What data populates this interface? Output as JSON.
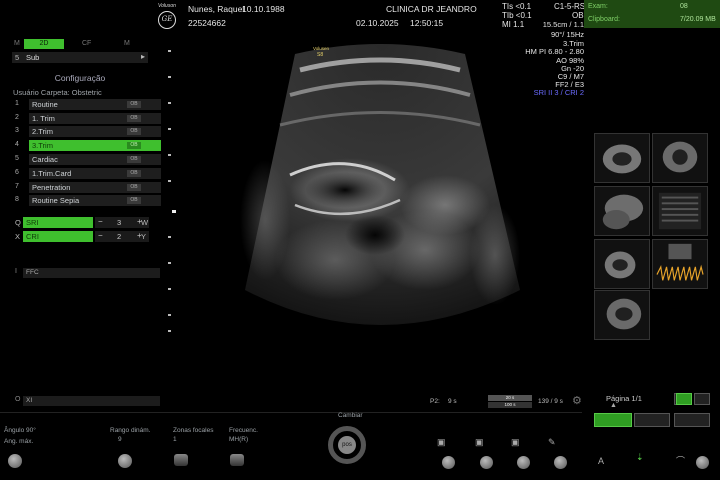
{
  "logo": {
    "brand": "Voluson",
    "mark": "GE"
  },
  "header": {
    "patient_name": "Nunes, Raquel",
    "patient_dob": "10.10.1988",
    "patient_id": "22524662",
    "clinic": "CLINICA DR JEANDRO",
    "date": "02.10.2025",
    "time": "12:50:15",
    "tis": "TIs <0.1",
    "tib": "TIb <0.1",
    "mi": "MI  1.1",
    "probe": "C1-5-RS",
    "app": "OB"
  },
  "status_panel": {
    "exam_label": "Exam:",
    "exam_value": "08",
    "clipboard_label": "Clipboard:",
    "clipboard_value": "7/20.09 MB"
  },
  "left_panel": {
    "tabs": [
      "M",
      "2D",
      "CF",
      "M"
    ],
    "sub_num": "5",
    "sub_label": "Sub",
    "sub_arrow": "▸",
    "title": "Configuração",
    "user_folder": "Usuário Carpeta: Obstetric",
    "presets": [
      {
        "num": "1",
        "label": "Routine",
        "tag": "OB"
      },
      {
        "num": "2",
        "label": "1. Trim",
        "tag": "OB"
      },
      {
        "num": "3",
        "label": "2.Trim",
        "tag": "OB"
      },
      {
        "num": "4",
        "label": "3.Trim",
        "tag": "OB"
      },
      {
        "num": "5",
        "label": "Cardiac",
        "tag": "OB"
      },
      {
        "num": "6",
        "label": "1.Trim.Card",
        "tag": "OB"
      },
      {
        "num": "7",
        "label": "Penetration",
        "tag": "OB"
      },
      {
        "num": "8",
        "label": "Routine Sepia",
        "tag": "OB"
      }
    ],
    "params": [
      {
        "key": "Q",
        "name": "SRI",
        "minus": "−",
        "value": "3",
        "plus": "+",
        "axis": "W"
      },
      {
        "key": "X",
        "name": "CRI",
        "minus": "−",
        "value": "2",
        "plus": "+",
        "axis": "Y"
      }
    ],
    "field_1": {
      "key": "I",
      "label": "FFC"
    },
    "field_2": {
      "key": "O",
      "label": "XI"
    }
  },
  "image_info": {
    "volume_badge": "Volusen",
    "volume_badge_2": "S8",
    "depth": "15.5cm / 1.1",
    "angle": "90°/ 15Hz",
    "preset": "3.Trim",
    "harmonic": "HM PI 6.80 - 2.80",
    "ao": "AO 98%",
    "gain": "Gn -20",
    "map": "C9 / M7",
    "frq": "FF2 / E3",
    "sri": "SRI II 3 / CRI 2"
  },
  "cine": {
    "p2_label": "P2:",
    "p2_value": "9 s",
    "track1": "20 s",
    "track2": "100 s",
    "frames": "139 / 9 s"
  },
  "thumbs_panel": {
    "page_label": "Página 1/1",
    "page_arrow": "▲"
  },
  "bottom_controls": {
    "k1_label": "Ângulo 90°",
    "k1_sub": "Ang. máx.",
    "k2_label": "Rango dinám.",
    "k2_value": "9",
    "k3_label": "Zonas focales",
    "k3_value": "1",
    "k4_label": "Frecuenc.",
    "k4_value": "MH(R)",
    "pos_label": "Cambiar",
    "pos_core": "pos"
  },
  "bottom_icons": {
    "floppy_glyph": "▣",
    "pen_glyph": "✎",
    "a_glyph": "A",
    "arrow_glyph": "⇣",
    "arc_glyph": "⌒"
  }
}
